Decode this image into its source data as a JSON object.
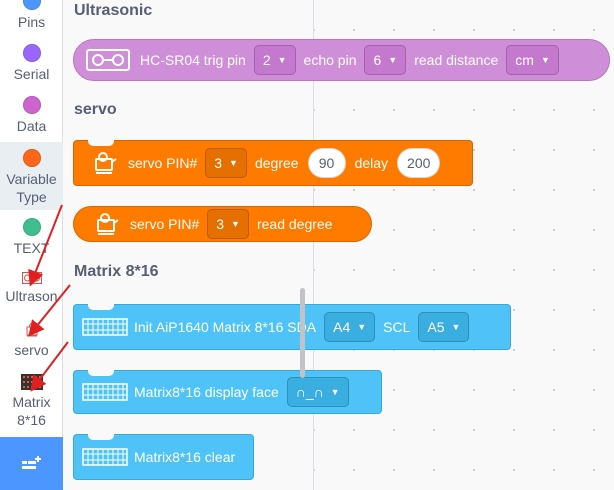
{
  "sidebar": {
    "items": [
      {
        "label": "Pins",
        "color": "#4c97ff"
      },
      {
        "label": "Serial",
        "color": "#9966ff"
      },
      {
        "label": "Data",
        "color": "#cf63cf"
      },
      {
        "label": "Variable",
        "label2": "Type",
        "color": "#ff661a"
      },
      {
        "label": "TEXT",
        "color": "#3fbf8f"
      },
      {
        "label": "Ultrason",
        "icon": "ultrasonic-sensor-icon"
      },
      {
        "label": "servo",
        "icon": "servo-icon"
      },
      {
        "label": "Matrix",
        "label2": "8*16",
        "icon": "led-matrix-icon"
      }
    ],
    "extension_icon": "add-extension-icon"
  },
  "sections": {
    "ultrasonic": "Ultrasonic",
    "servo": "servo",
    "matrix": "Matrix 8*16"
  },
  "blocks": {
    "ultrasonic": {
      "label_main": "HC-SR04 trig pin",
      "trig": "2",
      "label_echo": "echo pin",
      "echo": "6",
      "label_read": "read distance",
      "unit": "cm"
    },
    "servo_write": {
      "label_pin": "servo PIN#",
      "pin": "3",
      "label_degree": "degree",
      "degree": "90",
      "label_delay": "delay",
      "delay": "200"
    },
    "servo_read": {
      "label_pin": "servo PIN#",
      "pin": "3",
      "label_read": "read degree"
    },
    "matrix_init": {
      "label": "Init AiP1640 Matrix 8*16 SDA",
      "sda": "A4",
      "label_scl": "SCL",
      "scl": "A5"
    },
    "matrix_face": {
      "label": "Matrix8*16 display face",
      "face": "∩_∩"
    },
    "matrix_clear": {
      "label": "Matrix8*16 clear"
    }
  },
  "colors": {
    "ultrasonic_block": "#cf8fd8",
    "servo_block": "#ff7b00",
    "matrix_block": "#4fc3f7",
    "annotation_arrow": "#e02020"
  }
}
